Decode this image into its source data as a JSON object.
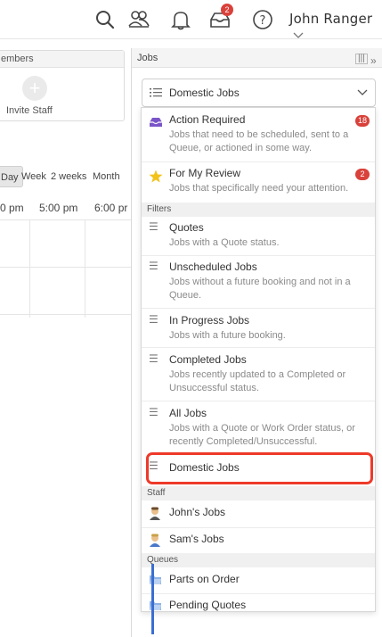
{
  "header": {
    "user_name": "John Ranger",
    "notification_badge": "2",
    "icons": [
      "search-icon",
      "users-icon",
      "bell-icon",
      "inbox-icon",
      "help-icon",
      "chevron-down-icon"
    ]
  },
  "left": {
    "members_title": "embers",
    "invite_label": "Invite Staff",
    "view_tabs": [
      "Day",
      "Week",
      "2 weeks",
      "Month"
    ],
    "times": [
      "0 pm",
      "5:00 pm",
      "6:00 pr"
    ]
  },
  "jobs": {
    "panel_title": "Jobs",
    "selected": "Domestic Jobs",
    "action_required": {
      "title": "Action Required",
      "desc": "Jobs that need to be scheduled, sent to a Queue, or actioned in some way.",
      "count": "18"
    },
    "for_my_review": {
      "title": "For My Review",
      "desc": "Jobs that specifically need your attention.",
      "count": "2"
    },
    "filters_label": "Filters",
    "filters": [
      {
        "title": "Quotes",
        "desc": "Jobs with a Quote status."
      },
      {
        "title": "Unscheduled Jobs",
        "desc": "Jobs without a future booking and not in a Queue."
      },
      {
        "title": "In Progress Jobs",
        "desc": "Jobs with a future booking."
      },
      {
        "title": "Completed Jobs",
        "desc": "Jobs recently updated to a Completed or Unsuccessful status."
      },
      {
        "title": "All Jobs",
        "desc": "Jobs with a Quote or Work Order status, or recently Completed/Unsuccessful."
      },
      {
        "title": "Domestic Jobs",
        "desc": ""
      }
    ],
    "staff_label": "Staff",
    "staff": [
      "John's Jobs",
      "Sam's Jobs"
    ],
    "queues_label": "Queues",
    "queues": [
      "Parts on Order",
      "Pending Quotes"
    ]
  },
  "colors": {
    "accent_red": "#d9413a",
    "highlight": "#ee3a2a",
    "blue": "#3b6ed2"
  }
}
